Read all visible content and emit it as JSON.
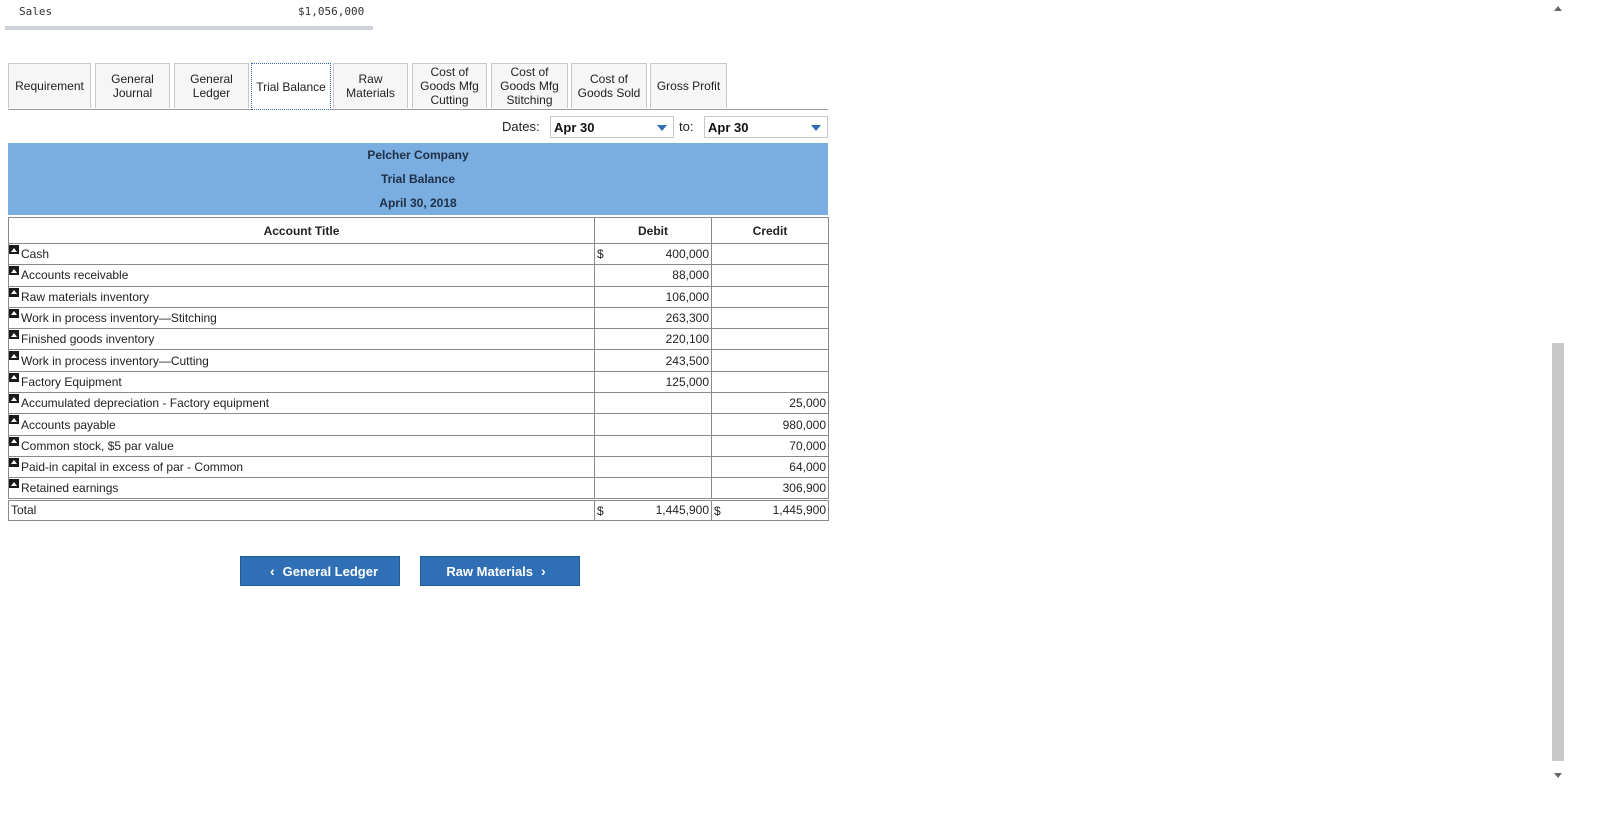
{
  "sales": {
    "label": "Sales",
    "value": "$1,056,000"
  },
  "tabs": [
    {
      "label": "Requirement"
    },
    {
      "label": "General\nJournal"
    },
    {
      "label": "General\nLedger"
    },
    {
      "label": "Trial Balance"
    },
    {
      "label": "Raw\nMaterials"
    },
    {
      "label": "Cost of\nGoods Mfg\nCutting"
    },
    {
      "label": "Cost of\nGoods Mfg\nStitching"
    },
    {
      "label": "Cost of\nGoods Sold"
    },
    {
      "label": "Gross Profit"
    }
  ],
  "active_tab": "Trial Balance",
  "dates": {
    "label": "Dates:",
    "from": "Apr 30",
    "to_label": "to:",
    "to": "Apr 30"
  },
  "header": {
    "company": "Pelcher Company",
    "report": "Trial Balance",
    "date": "April 30, 2018"
  },
  "table": {
    "columns": [
      "Account Title",
      "Debit",
      "Credit"
    ],
    "currency": "$",
    "rows": [
      {
        "account": "Cash",
        "debit": "400,000",
        "credit": ""
      },
      {
        "account": "Accounts receivable",
        "debit": "88,000",
        "credit": ""
      },
      {
        "account": "Raw materials inventory",
        "debit": "106,000",
        "credit": ""
      },
      {
        "account": "Work in process inventory—Stitching",
        "debit": "263,300",
        "credit": ""
      },
      {
        "account": "Finished goods inventory",
        "debit": "220,100",
        "credit": ""
      },
      {
        "account": "Work in process inventory—Cutting",
        "debit": "243,500",
        "credit": ""
      },
      {
        "account": "Factory Equipment",
        "debit": "125,000",
        "credit": ""
      },
      {
        "account": "Accumulated depreciation - Factory equipment",
        "debit": "",
        "credit": "25,000"
      },
      {
        "account": "Accounts payable",
        "debit": "",
        "credit": "980,000"
      },
      {
        "account": "Common stock, $5 par value",
        "debit": "",
        "credit": "70,000"
      },
      {
        "account": "Paid-in capital in excess of par - Common",
        "debit": "",
        "credit": "64,000"
      },
      {
        "account": "Retained earnings",
        "debit": "",
        "credit": "306,900"
      }
    ],
    "total": {
      "label": "Total",
      "debit": "1,445,900",
      "credit": "1,445,900"
    }
  },
  "nav": {
    "prev": "General Ledger",
    "next": "Raw Materials"
  },
  "colors": {
    "accent": "#2f6fb6",
    "header_band": "#7aade0"
  }
}
